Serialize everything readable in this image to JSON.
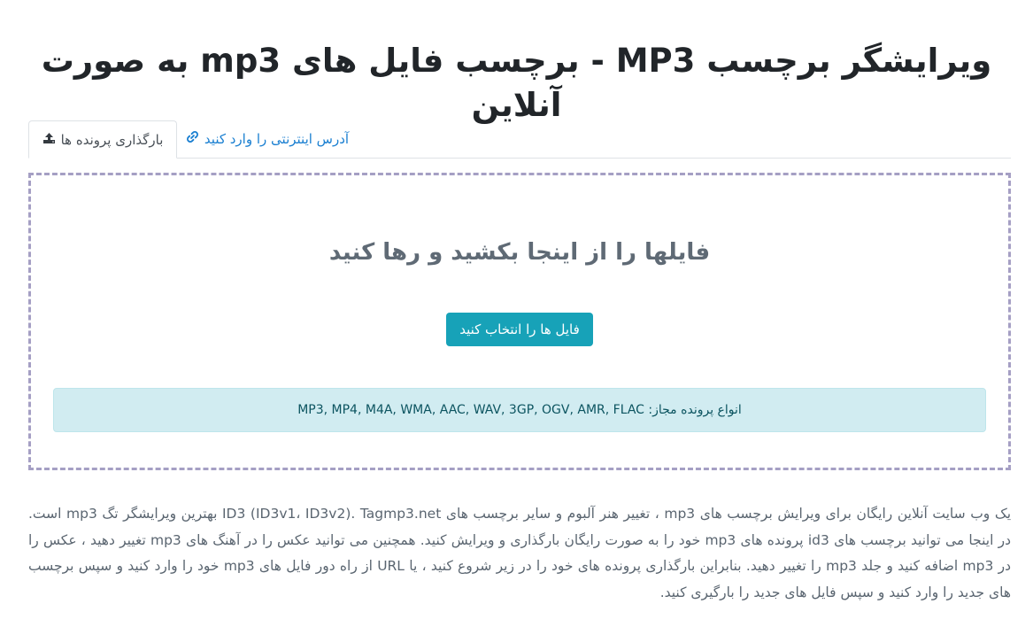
{
  "page": {
    "title": "ویرایشگر برچسب MP3 - برچسب فایل های mp3 به صورت آنلاین"
  },
  "tabs": [
    {
      "label": "بارگذاری پرونده ها",
      "icon": "upload-icon",
      "active": true
    },
    {
      "label": "آدرس اینترنتی را وارد کنید",
      "icon": "link-icon",
      "active": false
    }
  ],
  "dropzone": {
    "text": "فایلها را از اینجا بکشید و رها کنید",
    "button_label": "فایل ها را انتخاب کنید",
    "allowed_types": "انواع پرونده مجاز: MP3, MP4, M4A, WMA, AAC, WAV, 3GP, OGV, AMR, FLAC"
  },
  "description": "یک وب سایت آنلاین رایگان برای ویرایش برچسب های mp3 ، تغییر هنر آلبوم و سایر برچسب های ID3 (ID3v1، ID3v2). Tagmp3.net بهترین ویرایشگر تگ mp3 است. در اینجا می توانید برچسب های id3 پرونده های mp3 خود را به صورت رایگان بارگذاری و ویرایش کنید. همچنین می توانید عکس را در آهنگ های mp3 تغییر دهید ، عکس را در mp3 اضافه کنید و جلد mp3 را تغییر دهید. بنابراین بارگذاری پرونده های خود را در زیر شروع کنید ، یا URL از راه دور فایل های mp3 خود را وارد کنید و سپس برچسب های جدید را وارد کنید و سپس فایل های جدید را بارگیری کنید.",
  "colors": {
    "accent": "#17a2b8",
    "link": "#1a7fd1",
    "dropzone_border": "#a59fc4",
    "alert_bg": "#d1ecf1"
  }
}
